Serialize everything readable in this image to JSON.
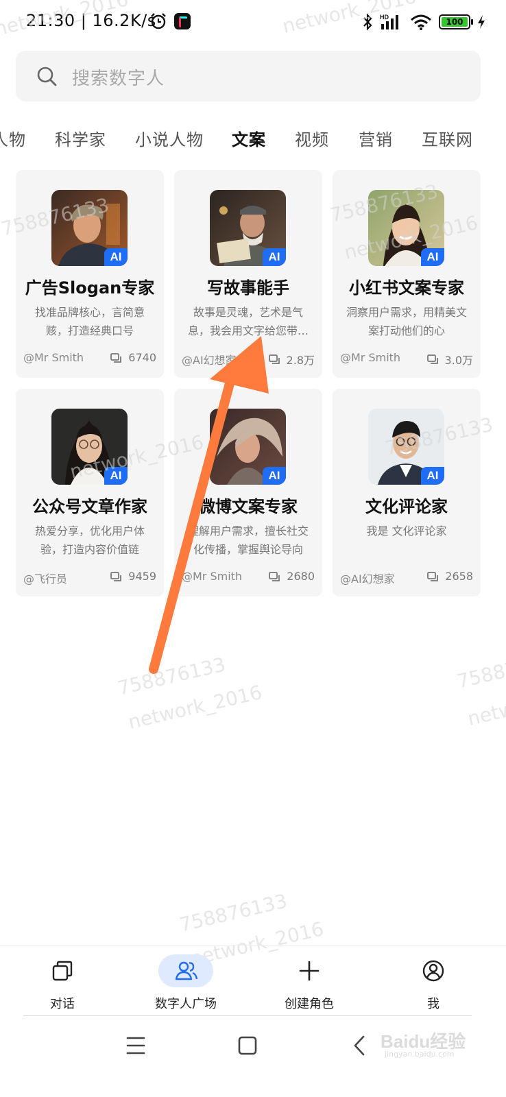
{
  "status_bar": {
    "time_speed": "21:30 | 16.2K/s",
    "battery": "100"
  },
  "search": {
    "placeholder": "搜索数字人"
  },
  "tabs": [
    {
      "label": "人物"
    },
    {
      "label": "科学家"
    },
    {
      "label": "小说人物"
    },
    {
      "label": "文案",
      "active": true
    },
    {
      "label": "视频"
    },
    {
      "label": "营销"
    },
    {
      "label": "互联网"
    }
  ],
  "cards": [
    {
      "title": "广告Slogan专家",
      "desc": "找准品牌核心，言简意赅，打造经典口号",
      "author": "@Mr Smith",
      "count": "6740",
      "badge": "AI"
    },
    {
      "title": "写故事能手",
      "desc": "故事是灵魂，艺术是气息，我会用文字给您带…",
      "author": "@AI幻想家",
      "count": "2.8万",
      "badge": "AI"
    },
    {
      "title": "小红书文案专家",
      "desc": "洞察用户需求，用精美文案打动他们的心",
      "author": "@Mr Smith",
      "count": "3.0万",
      "badge": "AI"
    },
    {
      "title": "公众号文章作家",
      "desc": "热爱分享，优化用户体验，打造内容价值链",
      "author": "@飞行员",
      "count": "9459",
      "badge": "AI"
    },
    {
      "title": "微博文案专家",
      "desc": "理解用户需求，擅长社交化传播，掌握舆论导向",
      "author": "@Mr Smith",
      "count": "2680",
      "badge": "AI"
    },
    {
      "title": "文化评论家",
      "desc": "我是 文化评论家",
      "author": "@AI幻想家",
      "count": "2658",
      "badge": "AI"
    }
  ],
  "bottom_nav": [
    {
      "label": "对话",
      "icon": "chat-icon"
    },
    {
      "label": "数字人广场",
      "icon": "people-icon",
      "active": true
    },
    {
      "label": "创建角色",
      "icon": "plus-icon"
    },
    {
      "label": "我",
      "icon": "profile-icon"
    }
  ],
  "watermarks": {
    "number": "758876133",
    "handle": "network_2016",
    "baidu": "Baidu经验",
    "baidu_url": "jingyan.baidu.com"
  },
  "colors": {
    "accent": "#1f6df5",
    "arrow": "#ff7a3d",
    "card_bg": "#f5f5f6",
    "nav_active_bg": "#dfeafe"
  }
}
